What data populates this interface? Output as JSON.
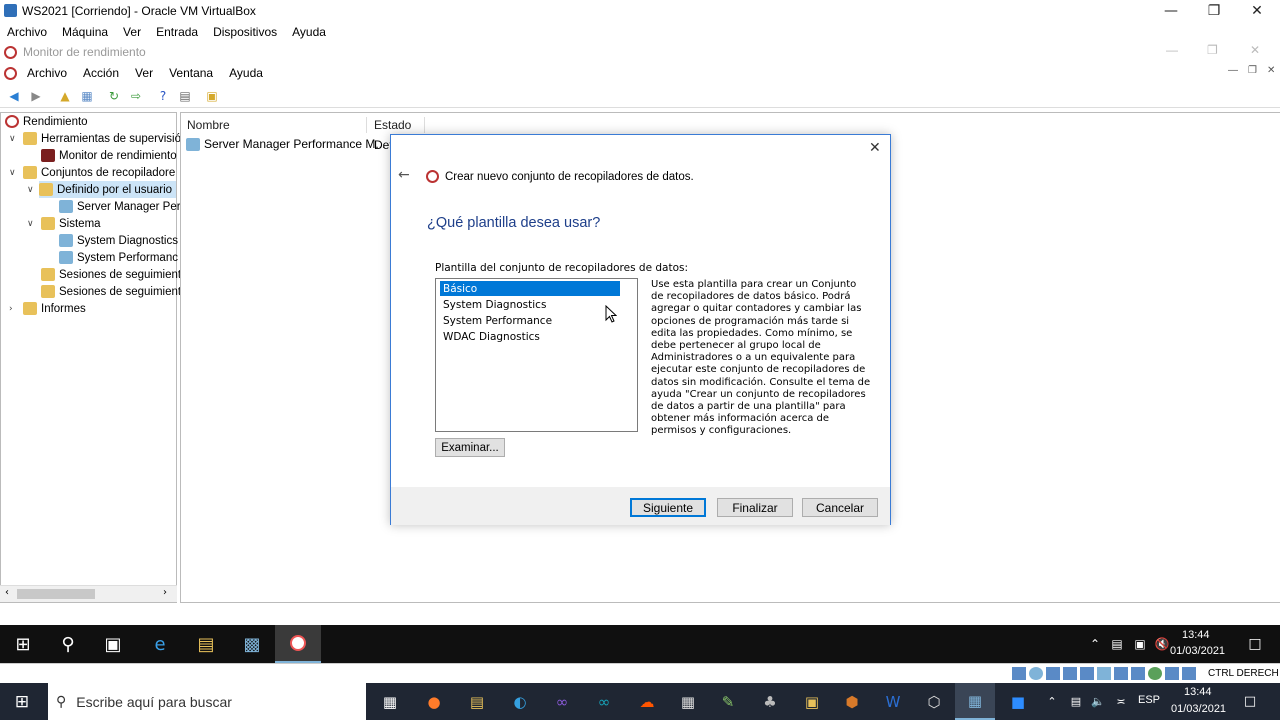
{
  "vbox": {
    "title": "WS2021 [Corriendo] - Oracle VM VirtualBox",
    "menu": [
      "Archivo",
      "Máquina",
      "Ver",
      "Entrada",
      "Dispositivos",
      "Ayuda"
    ]
  },
  "mmc": {
    "title": "Monitor de rendimiento",
    "menu": [
      "Archivo",
      "Acción",
      "Ver",
      "Ventana",
      "Ayuda"
    ]
  },
  "tree": {
    "items": [
      {
        "label": "Rendimiento"
      },
      {
        "label": "Herramientas de supervisió"
      },
      {
        "label": "Monitor de rendimiento"
      },
      {
        "label": "Conjuntos de recopiladore"
      },
      {
        "label": "Definido por el usuario"
      },
      {
        "label": "Server Manager Per"
      },
      {
        "label": "Sistema"
      },
      {
        "label": "System Diagnostics"
      },
      {
        "label": "System Performanc"
      },
      {
        "label": "Sesiones de seguimient"
      },
      {
        "label": "Sesiones de seguimient"
      },
      {
        "label": "Informes"
      }
    ]
  },
  "list": {
    "columns": [
      "Nombre",
      "Estado"
    ],
    "rows": [
      {
        "name": "Server Manager Performance M...",
        "status": "Det"
      }
    ]
  },
  "dialog": {
    "header": "Crear nuevo conjunto de recopiladores de datos.",
    "question": "¿Qué plantilla desea usar?",
    "list_label": "Plantilla del conjunto de recopiladores de datos:",
    "templates": [
      "Básico",
      "System Diagnostics",
      "System Performance",
      "WDAC Diagnostics"
    ],
    "selected_template": "Básico",
    "description": "Use esta plantilla para crear un Conjunto de recopiladores de datos básico. Podrá agregar o quitar contadores y cambiar las opciones de programación más tarde si edita las propiedades. Como mínimo, se debe pertenecer al grupo local de Administradores o a un equivalente para ejecutar este conjunto de recopiladores de datos sin modificación. Consulte el tema de ayuda \"Crear un conjunto de recopiladores de datos a partir de una plantilla\" para obtener más información acerca de permisos y configuraciones.",
    "browse": "Examinar...",
    "next": "Siguiente",
    "finish": "Finalizar",
    "cancel": "Cancelar"
  },
  "vm_clock": {
    "time": "13:44",
    "date": "01/03/2021"
  },
  "vbox_status": {
    "hostkey": "CTRL DERECH"
  },
  "host": {
    "search_placeholder": "Escribe aquí para buscar",
    "lang": "ESP",
    "time": "13:44",
    "date": "01/03/2021"
  },
  "colors": {
    "accent": "#0078d7",
    "selection": "#0078d7",
    "taskbar": "#101010"
  }
}
